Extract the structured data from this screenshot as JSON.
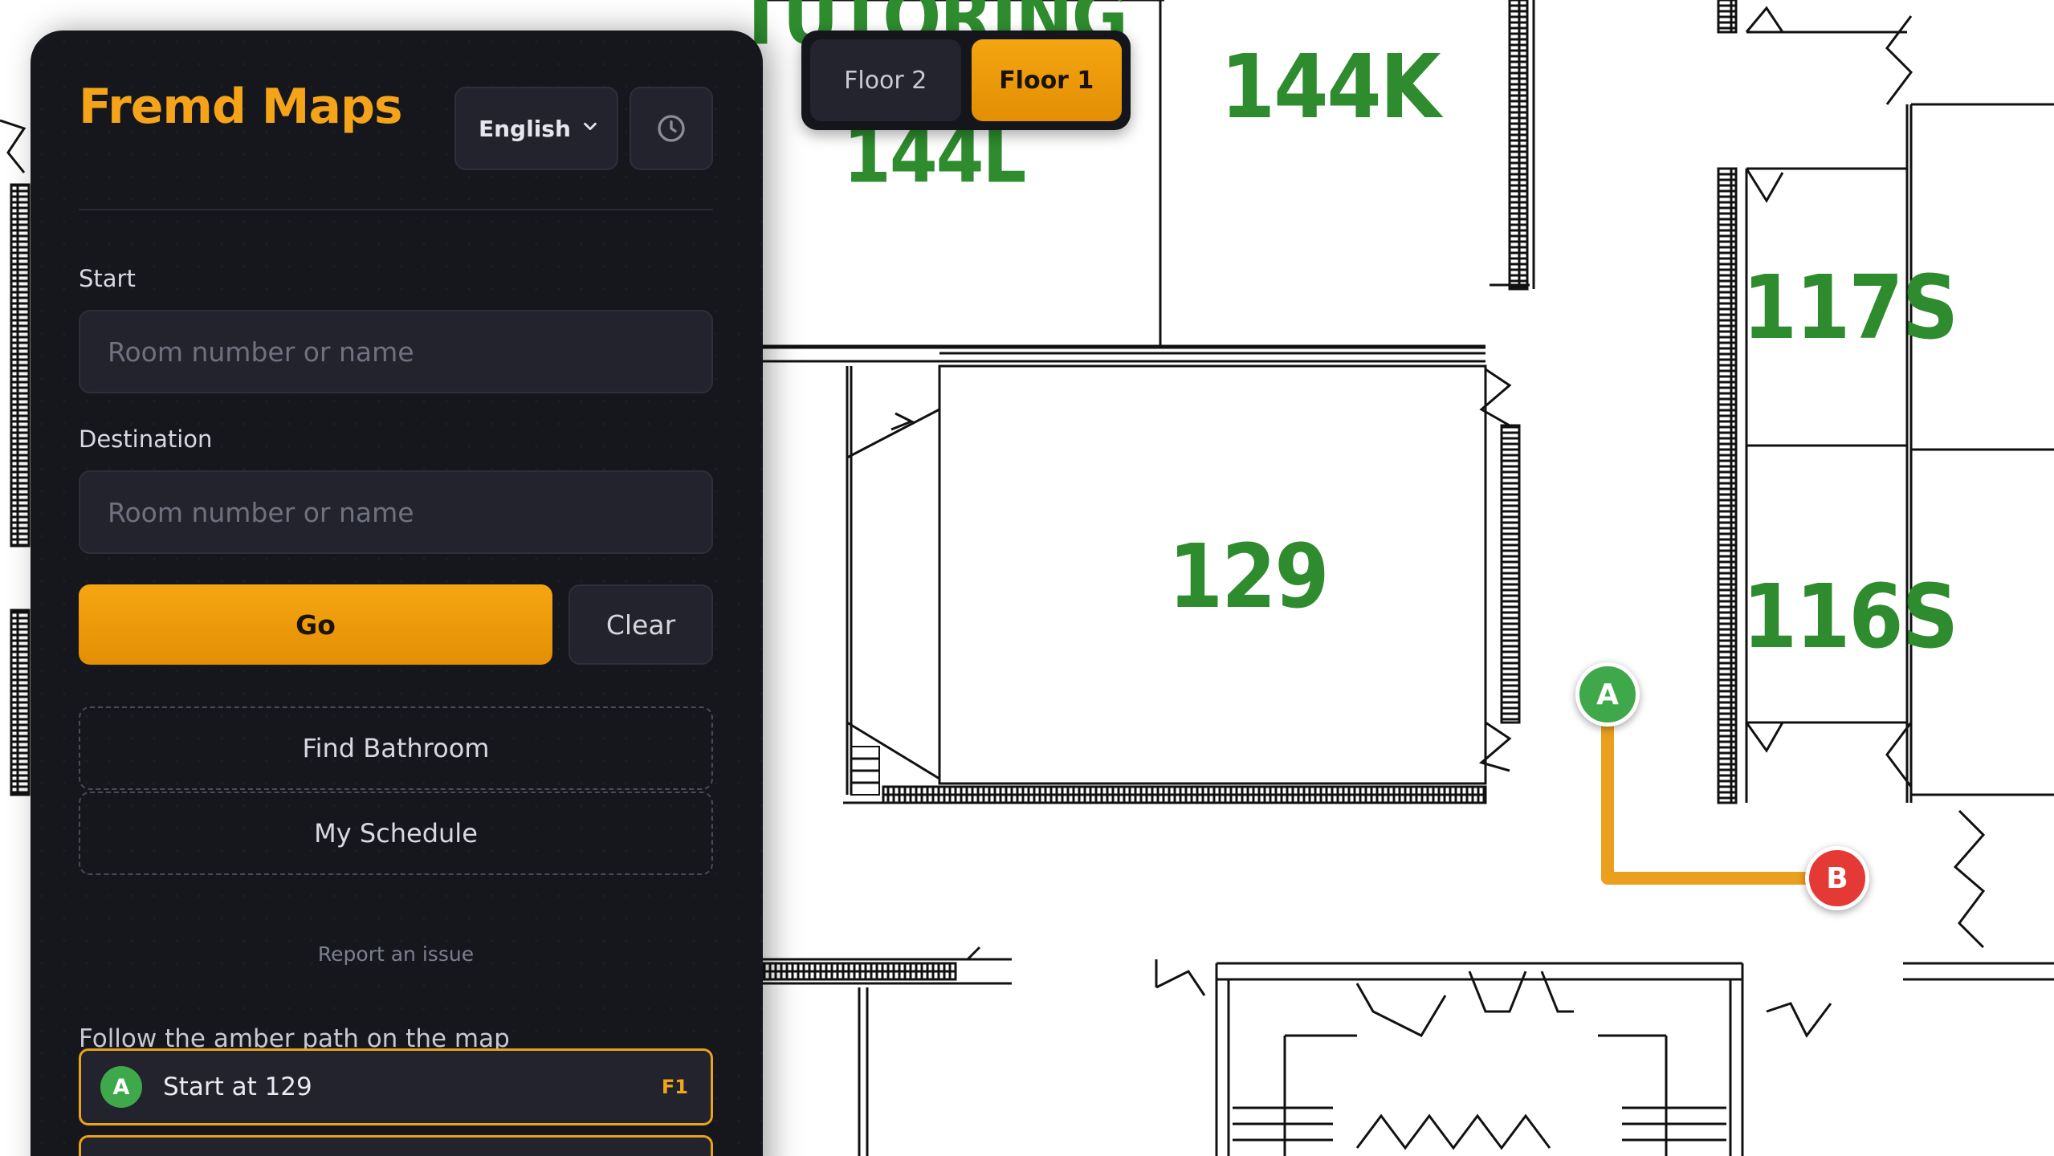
{
  "app": {
    "brand": "Fremd Maps",
    "language": {
      "selected": "English"
    }
  },
  "floors": {
    "items": [
      {
        "label": "Floor 2",
        "active": false
      },
      {
        "label": "Floor 1",
        "active": true
      }
    ]
  },
  "form": {
    "start_label": "Start",
    "start_placeholder": "Room number or name",
    "destination_label": "Destination",
    "destination_placeholder": "Room number or name",
    "go_label": "Go",
    "clear_label": "Clear",
    "find_bathroom_label": "Find Bathroom",
    "schedule_label": "My Schedule",
    "report_label": "Report an issue"
  },
  "directions": {
    "intro": "Follow the amber path on the map",
    "steps": [
      {
        "badge": "A",
        "text": "Start at 129",
        "floor": "F1",
        "color": "#3fa84a"
      }
    ]
  },
  "map": {
    "rooms": [
      "TUTORING",
      "144L",
      "144K",
      "129",
      "117S",
      "116S"
    ],
    "markers": {
      "start": "A",
      "end": "B"
    },
    "colors": {
      "path": "#eaa01c",
      "start": "#3fa84a",
      "end": "#e53935",
      "room_label": "#2e8b2e"
    }
  }
}
